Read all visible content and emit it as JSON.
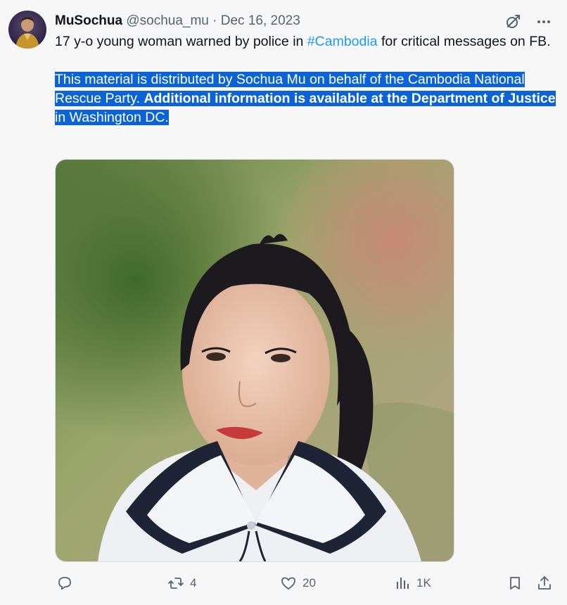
{
  "author": {
    "display_name": "MuSochua",
    "handle": "@sochua_mu",
    "separator": "·",
    "date": "Dec 16, 2023"
  },
  "tweet": {
    "text_before": "17 y-o young woman warned by police in ",
    "hashtag": "#Cambodia",
    "text_after": " for critical messages on FB.",
    "disclosure_part1": "This material is distributed by Sochua Mu on behalf of the Cambodia National Rescue Party. ",
    "disclosure_bold1": "Additional information is available at the",
    "disclosure_space": " ",
    "disclosure_bold2": "Department of Justice",
    "disclosure_part2": " in Washington DC."
  },
  "actions": {
    "reply_count": "",
    "retweet_count": "4",
    "like_count": "20",
    "views_count": "1K"
  },
  "colors": {
    "accent": "#1d9bf0",
    "highlight": "#0b63d5",
    "muted": "#536471"
  },
  "icons": [
    "grok-icon",
    "more-icon",
    "reply-icon",
    "retweet-icon",
    "like-icon",
    "views-icon",
    "bookmark-icon",
    "share-icon"
  ]
}
